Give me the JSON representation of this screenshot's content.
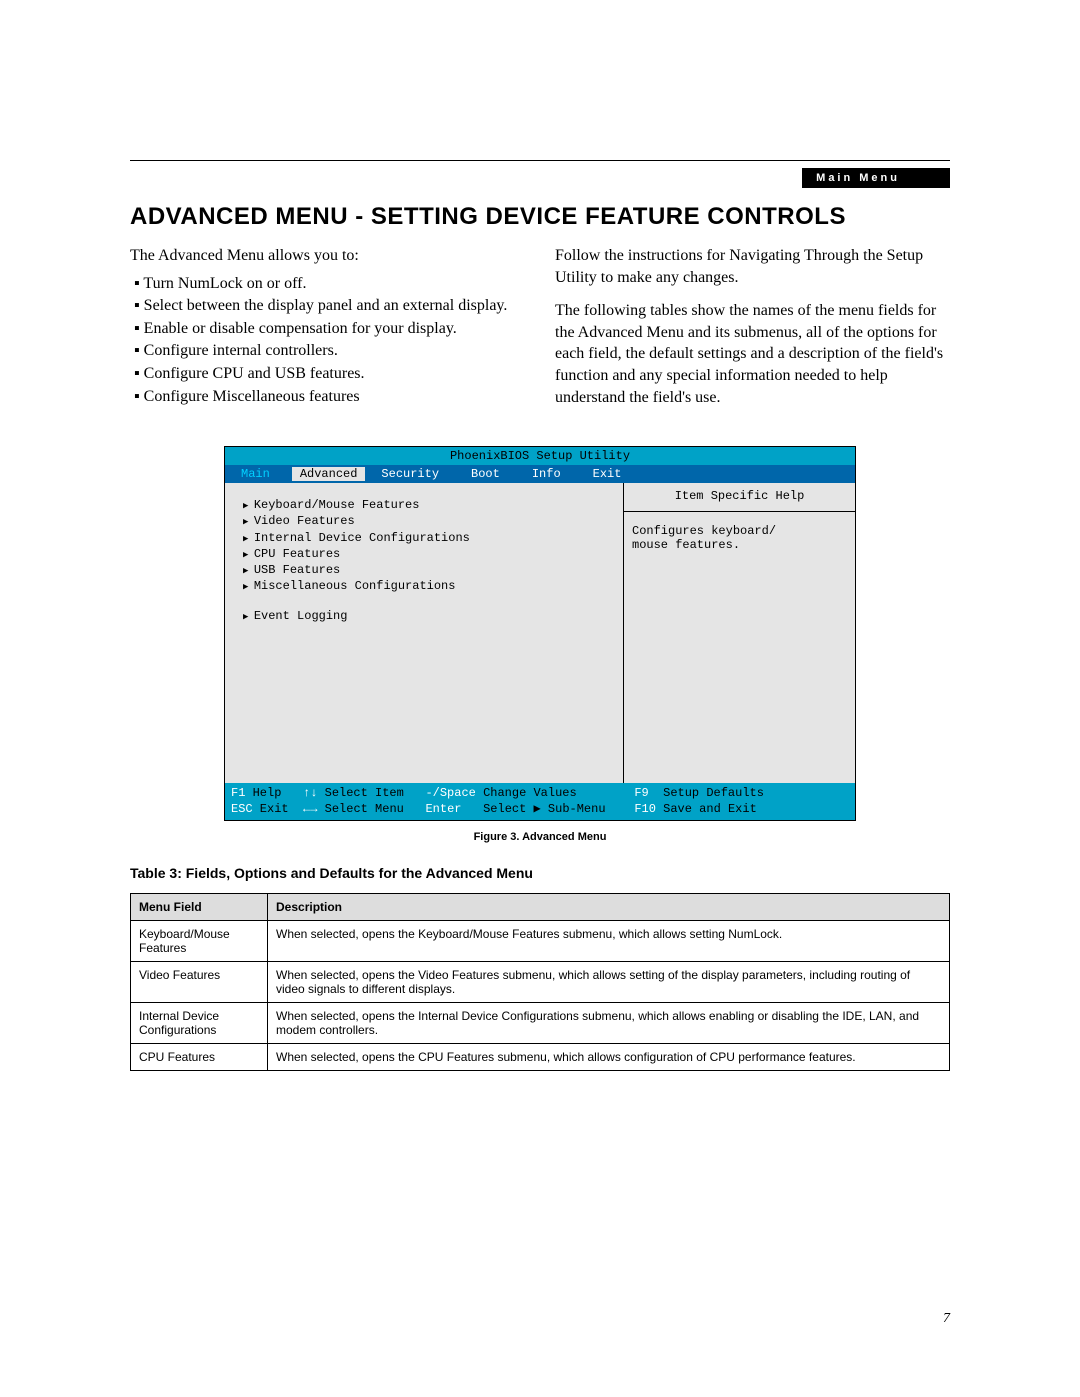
{
  "header": {
    "label": "Main Menu"
  },
  "heading": "ADVANCED MENU - SETTING DEVICE FEATURE CONTROLS",
  "left_intro": "The Advanced Menu allows you to:",
  "bullets": [
    "Turn NumLock on or off.",
    "Select between the display panel and an external display.",
    "Enable or disable compensation for your display.",
    "Configure internal controllers.",
    "Configure CPU and USB features.",
    "Configure Miscellaneous features"
  ],
  "right_paras": [
    "Follow the instructions for Navigating Through the Setup Utility to make any changes.",
    "The following tables show the names of the menu fields for the Advanced Menu and its submenus, all of the options for each field, the default settings and a description of the field's function and any special information needed to help understand the field's use."
  ],
  "bios": {
    "title": "PhoenixBIOS Setup Utility",
    "tabs": [
      "Main",
      "Advanced",
      "Security",
      "Boot",
      "Info",
      "Exit"
    ],
    "items": [
      "Keyboard/Mouse Features",
      "Video Features",
      "Internal Device Configurations",
      "CPU Features",
      "USB Features",
      "Miscellaneous Configurations"
    ],
    "extra_item": "Event Logging",
    "help_title": "Item Specific Help",
    "help_body": "Configures keyboard/\nmouse features.",
    "footer": {
      "r1": {
        "k1": "F1",
        "v1": " Help   ",
        "k2": "↑↓",
        "v2": " Select Item   ",
        "k3": "-/Space",
        "v3": " Change Values        ",
        "k4": "F9",
        "v4": "  Setup Defaults"
      },
      "r2": {
        "k1": "ESC",
        "v1": " Exit  ",
        "k2": "←→",
        "v2": " Select Menu   ",
        "k3": "Enter",
        "v3": "   Select ▶ Sub-Menu    ",
        "k4": "F10",
        "v4": " Save and Exit"
      }
    }
  },
  "fig_caption": "Figure 3.  Advanced Menu",
  "table_caption": "Table 3: Fields, Options and Defaults for the Advanced Menu",
  "table": {
    "headers": [
      "Menu Field",
      "Description"
    ],
    "rows": [
      [
        "Keyboard/Mouse Features",
        "When selected, opens the Keyboard/Mouse Features submenu, which allows setting NumLock."
      ],
      [
        "Video Features",
        "When selected, opens the Video Features submenu, which allows setting of the display parameters, including routing of video signals to different displays."
      ],
      [
        "Internal Device Configurations",
        "When selected, opens the Internal Device Configurations submenu, which allows enabling or disabling the IDE, LAN, and modem controllers."
      ],
      [
        "CPU Features",
        "When selected, opens the CPU Features submenu, which allows configuration of CPU performance features."
      ]
    ]
  },
  "page_number": "7"
}
